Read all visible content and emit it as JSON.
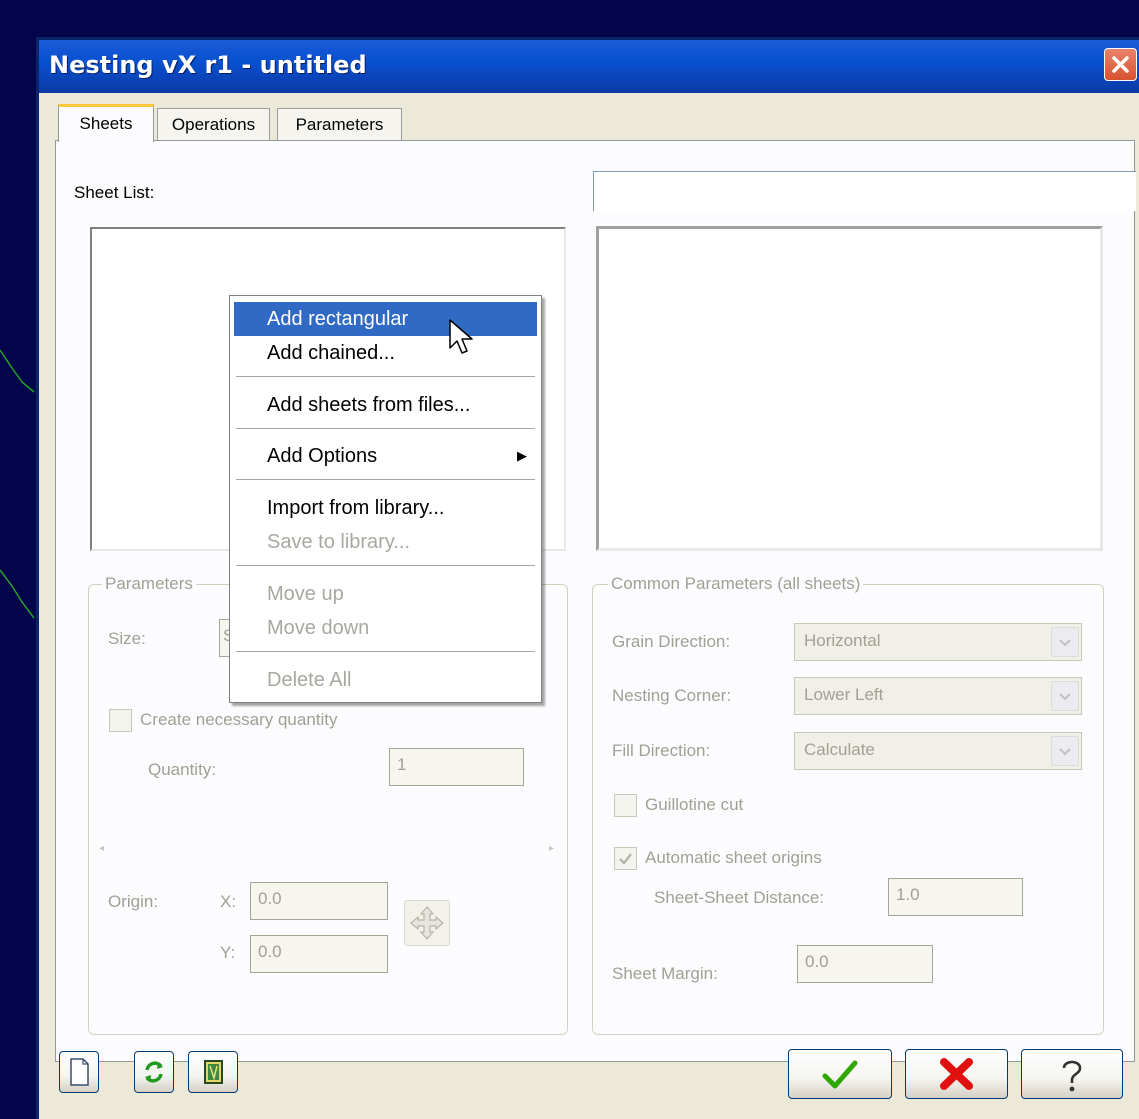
{
  "window": {
    "title": "Nesting vX r1 - untitled"
  },
  "tabs": [
    "Sheets",
    "Operations",
    "Parameters"
  ],
  "sheet_list": {
    "label": "Sheet List:"
  },
  "context_menu": {
    "items": [
      "Add rectangular",
      "Add chained...",
      "Add sheets from files...",
      "Add Options",
      "Import from library...",
      "Save to library...",
      "Move up",
      "Move down",
      "Delete All"
    ],
    "highlighted": "Add rectangular"
  },
  "parameters": {
    "title": "Parameters",
    "size_label": "Size:",
    "size_value": "S",
    "create_qty_label": "Create necessary quantity",
    "quantity_label": "Quantity:",
    "quantity_value": "1",
    "origin_label": "Origin:",
    "x_label": "X:",
    "x_value": "0.0",
    "y_label": "Y:",
    "y_value": "0.0"
  },
  "common": {
    "title": "Common Parameters (all sheets)",
    "grain_label": "Grain Direction:",
    "grain_value": "Horizontal",
    "corner_label": "Nesting Corner:",
    "corner_value": "Lower Left",
    "fill_label": "Fill Direction:",
    "fill_value": "Calculate",
    "guillotine_label": "Guillotine cut",
    "guillotine_checked": false,
    "auto_label": "Automatic sheet origins",
    "auto_checked": true,
    "distance_label": "Sheet-Sheet Distance:",
    "distance_value": "1.0",
    "margin_label": "Sheet Margin:",
    "margin_value": "0.0"
  },
  "colors": {
    "title_bar": "#0a46c0",
    "menu_highlight": "#316ac5",
    "ok_check": "#2ea800",
    "cancel_x": "#e01010",
    "tab_accent": "#ffc83c"
  },
  "icons": [
    "close-icon",
    "new-sheet-icon",
    "refresh-icon",
    "library-icon",
    "ok-check-icon",
    "cancel-x-icon",
    "help-icon",
    "submenu-arrow-icon",
    "move-origin-icon",
    "mouse-cursor-icon"
  ]
}
